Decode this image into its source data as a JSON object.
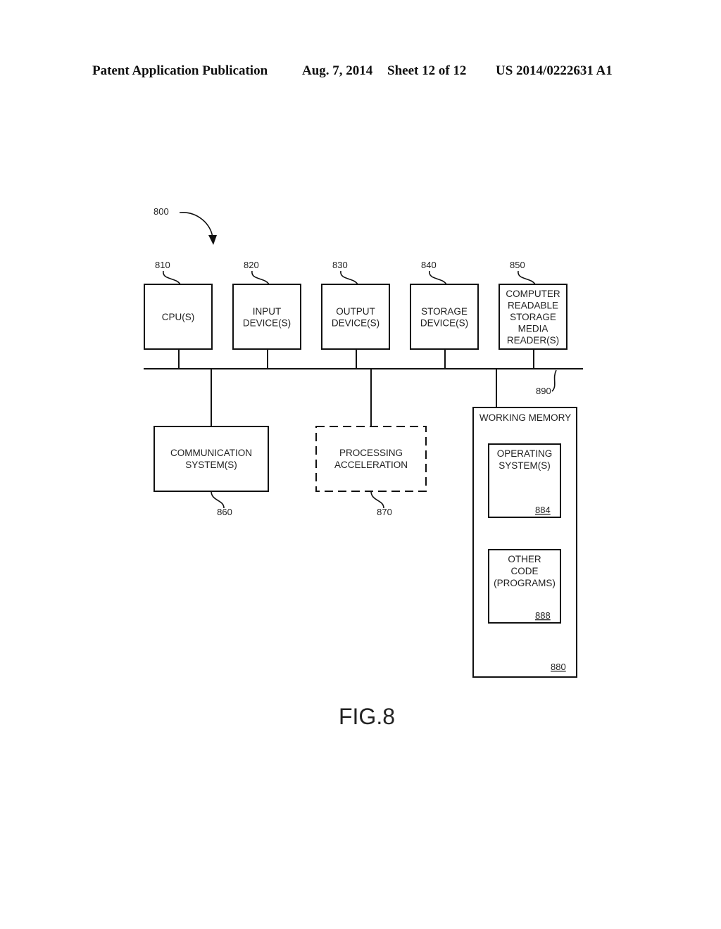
{
  "header": {
    "publication": "Patent Application Publication",
    "date": "Aug. 7, 2014",
    "sheet": "Sheet 12 of 12",
    "number": "US 2014/0222631 A1"
  },
  "figure": {
    "ref": "800",
    "caption": "FIG.8",
    "bus_ref": "890",
    "top_components": [
      {
        "ref": "810",
        "lines": [
          "CPU(S)"
        ]
      },
      {
        "ref": "820",
        "lines": [
          "INPUT",
          "DEVICE(S)"
        ]
      },
      {
        "ref": "830",
        "lines": [
          "OUTPUT",
          "DEVICE(S)"
        ]
      },
      {
        "ref": "840",
        "lines": [
          "STORAGE",
          "DEVICE(S)"
        ]
      },
      {
        "ref": "850",
        "lines": [
          "COMPUTER",
          "READABLE",
          "STORAGE",
          "MEDIA",
          "READER(S)"
        ]
      }
    ],
    "communication": {
      "ref": "860",
      "lines": [
        "COMMUNICATION",
        "SYSTEM(S)"
      ]
    },
    "acceleration": {
      "ref": "870",
      "lines": [
        "PROCESSING",
        "ACCELERATION"
      ],
      "style": "dashed"
    },
    "working_memory": {
      "ref": "880",
      "title": "WORKING MEMORY",
      "children": [
        {
          "ref": "884",
          "lines": [
            "OPERATING",
            "SYSTEM(S)"
          ]
        },
        {
          "ref": "888",
          "lines": [
            "OTHER",
            "CODE",
            "(PROGRAMS)"
          ]
        }
      ]
    }
  }
}
